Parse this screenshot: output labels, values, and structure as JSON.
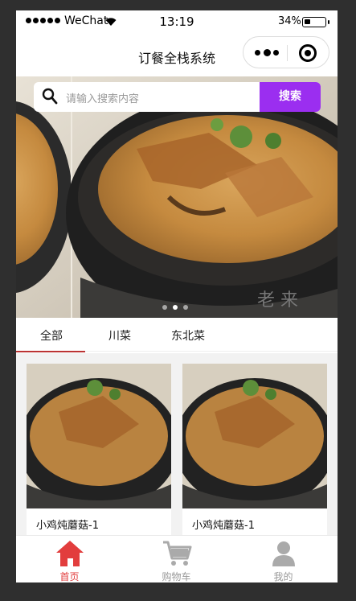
{
  "status_bar": {
    "carrier": "WeChat",
    "time": "13:19",
    "battery": "34%"
  },
  "nav": {
    "title": "订餐全栈系统"
  },
  "search": {
    "placeholder": "请输入搜索内容",
    "button": "搜索"
  },
  "banner": {
    "slide_count": 3,
    "active_slide": 2
  },
  "tabs": [
    {
      "label": "全部",
      "active": true
    },
    {
      "label": "川菜",
      "active": false
    },
    {
      "label": "东北菜",
      "active": false
    }
  ],
  "products": [
    {
      "name": "小鸡炖蘑菇-1"
    },
    {
      "name": "小鸡炖蘑菇-1"
    }
  ],
  "tabbar": [
    {
      "label": "首页",
      "icon": "home-icon",
      "active": true
    },
    {
      "label": "购物车",
      "icon": "cart-icon",
      "active": false
    },
    {
      "label": "我的",
      "icon": "user-icon",
      "active": false
    }
  ],
  "colors": {
    "accent": "#9b2ef0",
    "active_tab": "#e23d3d",
    "tab_underline": "#b33333"
  }
}
